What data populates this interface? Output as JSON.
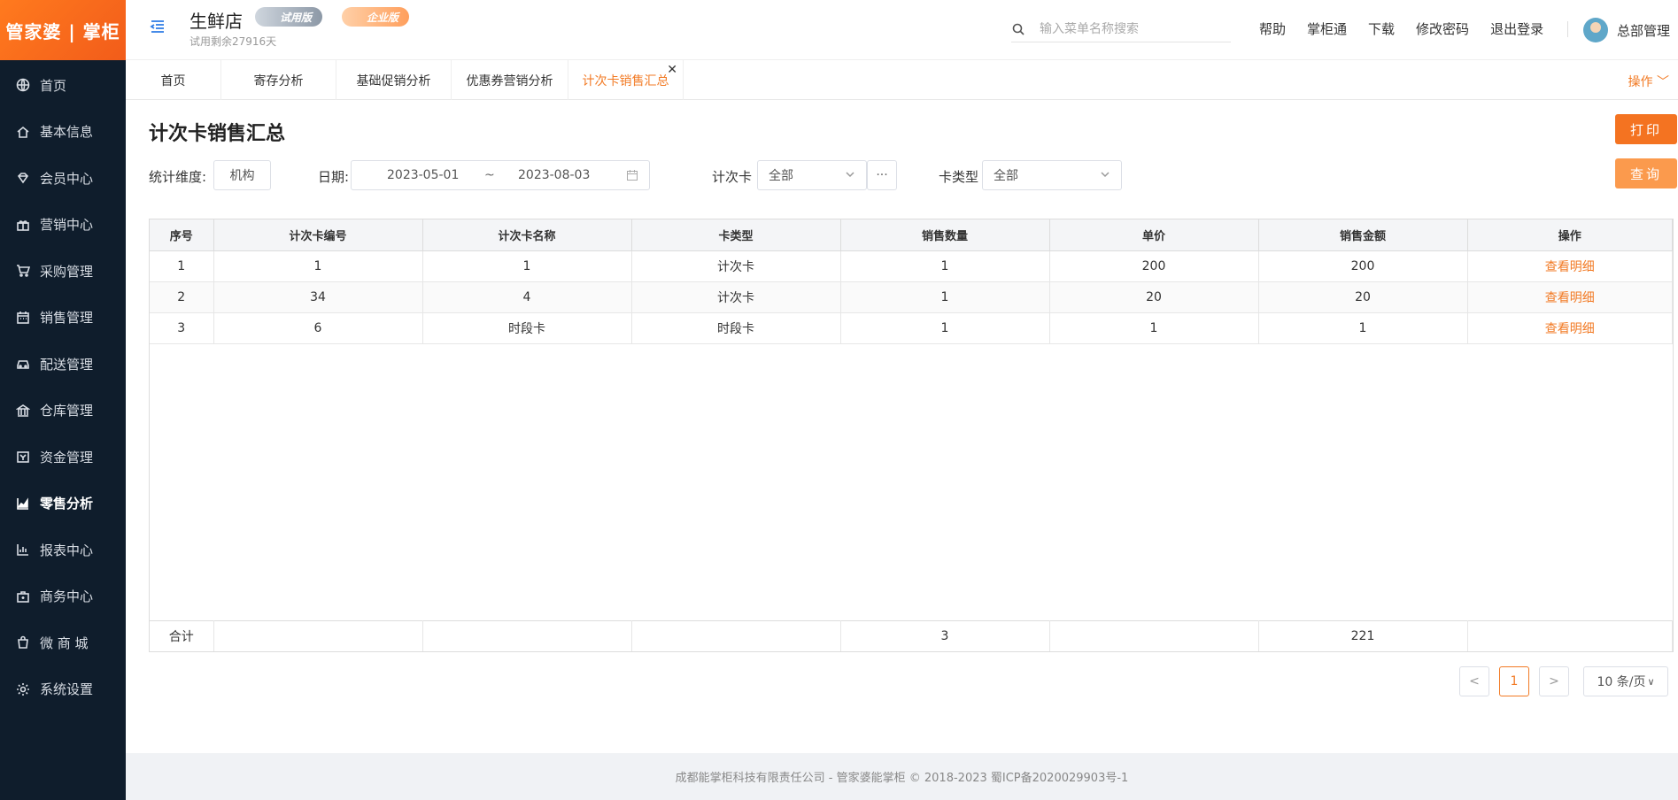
{
  "brand": {
    "logo_text": "管家婆 | 掌柜",
    "accent": "#f27a24"
  },
  "sidebar": {
    "items": [
      {
        "label": "首页",
        "icon": "globe-icon"
      },
      {
        "label": "基本信息",
        "icon": "home-icon"
      },
      {
        "label": "会员中心",
        "icon": "diamond-icon"
      },
      {
        "label": "营销中心",
        "icon": "gift-icon"
      },
      {
        "label": "采购管理",
        "icon": "cart-icon"
      },
      {
        "label": "销售管理",
        "icon": "calendar-icon"
      },
      {
        "label": "配送管理",
        "icon": "car-icon"
      },
      {
        "label": "仓库管理",
        "icon": "bank-icon"
      },
      {
        "label": "资金管理",
        "icon": "wallet-icon"
      },
      {
        "label": "零售分析",
        "icon": "area-chart-icon"
      },
      {
        "label": "报表中心",
        "icon": "bar-chart-icon"
      },
      {
        "label": "商务中心",
        "icon": "briefcase-icon"
      },
      {
        "label": "微 商 城",
        "icon": "shopping-bag-icon"
      },
      {
        "label": "系统设置",
        "icon": "gear-icon"
      }
    ],
    "active_index": 9
  },
  "header": {
    "store_name": "生鲜店",
    "badge_trial": "试用版",
    "badge_enterprise": "企业版",
    "trial_remaining": "试用剩余27916天",
    "search_placeholder": "输入菜单名称搜索",
    "links": [
      "帮助",
      "掌柜通",
      "下载",
      "修改密码",
      "退出登录"
    ],
    "user_name": "总部管理"
  },
  "tabs": {
    "items": [
      "首页",
      "寄存分析",
      "基础促销分析",
      "优惠券营销分析",
      "计次卡销售汇总"
    ],
    "active_index": 4,
    "ops_label": "操作"
  },
  "page": {
    "title": "计次卡销售汇总",
    "print_label": "打印",
    "query_label": "查询"
  },
  "filters": {
    "dimension_label": "统计维度:",
    "dimension_value": "机构",
    "date_label": "日期:",
    "date_start": "2023-05-01",
    "date_sep": "~",
    "date_end": "2023-08-03",
    "card_label": "计次卡",
    "card_value": "全部",
    "more_label": "···",
    "card_type_label": "卡类型",
    "card_type_value": "全部"
  },
  "table": {
    "columns": [
      "序号",
      "计次卡编号",
      "计次卡名称",
      "卡类型",
      "销售数量",
      "单价",
      "销售金额",
      "操作"
    ],
    "rows": [
      [
        "1",
        "1",
        "1",
        "计次卡",
        "1",
        "200",
        "200",
        "查看明细"
      ],
      [
        "2",
        "34",
        "4",
        "计次卡",
        "1",
        "20",
        "20",
        "查看明细"
      ],
      [
        "3",
        "6",
        "时段卡",
        "时段卡",
        "1",
        "1",
        "1",
        "查看明细"
      ]
    ],
    "summary": [
      "合计",
      "",
      "",
      "",
      "3",
      "",
      "221",
      ""
    ]
  },
  "pagination": {
    "prev": "<",
    "current": "1",
    "next": ">",
    "page_size": "10 条/页"
  },
  "footer": {
    "text": "成都能掌柜科技有限责任公司 - 管家婆能掌柜 © 2018-2023 蜀ICP备2020029903号-1"
  }
}
